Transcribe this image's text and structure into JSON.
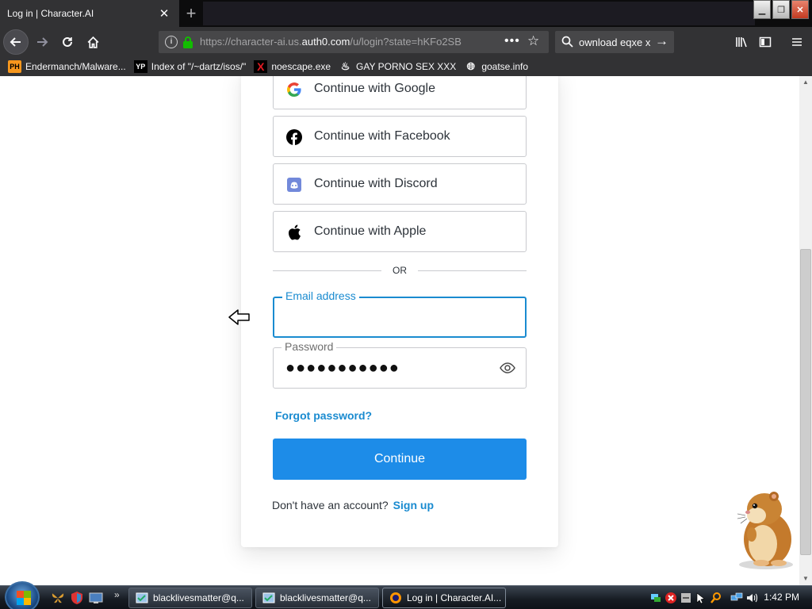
{
  "browser": {
    "tab_title": "Log in | Character.AI",
    "url_prefix": "https://character-ai.us.",
    "url_domain": "auth0.com",
    "url_suffix": "/u/login?state=hKFo2SB",
    "search_text": "ownload eqxe x"
  },
  "bookmarks": [
    {
      "icon_text": "PH",
      "label": "Endermanch/Malware..."
    },
    {
      "icon_text": "YP",
      "label": "Index of \"/~dartz/isos/\""
    },
    {
      "icon_text": "X",
      "label": "noescape.exe"
    },
    {
      "icon_text": "",
      "label": "GAY PORNO SEX XXX"
    },
    {
      "icon_text": "",
      "label": "goatse.info"
    }
  ],
  "login": {
    "social": {
      "google": "Continue with Google",
      "facebook": "Continue with Facebook",
      "discord": "Continue with Discord",
      "apple": "Continue with Apple"
    },
    "or_text": "OR",
    "email_label": "Email address",
    "email_value": "",
    "password_label": "Password",
    "password_masked": "●●●●●●●●●●●",
    "forgot_password": "Forgot password?",
    "continue_label": "Continue",
    "no_account_text": "Don't have an account?",
    "signup_label": "Sign up"
  },
  "taskbar": {
    "buttons": [
      {
        "label": "blacklivesmatter@q..."
      },
      {
        "label": "blacklivesmatter@q..."
      },
      {
        "label": "Log in | Character.AI..."
      }
    ],
    "clock": "1:42 PM"
  },
  "colors": {
    "accent": "#1d8ce8",
    "link": "#1a8bd0",
    "browser_chrome": "#323234"
  }
}
